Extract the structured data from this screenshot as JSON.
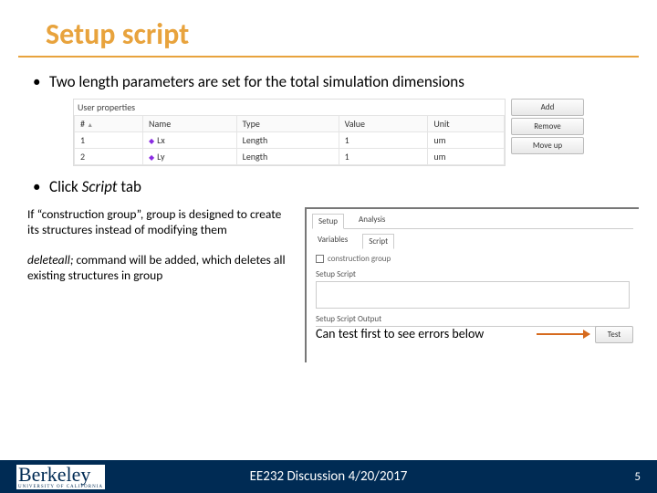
{
  "title": "Setup script",
  "bullets": {
    "b1": "Two length parameters are set for the total simulation dimensions",
    "b2_pre": "Click ",
    "b2_em": "Script",
    "b2_post": " tab"
  },
  "props": {
    "caption": "User properties",
    "headers": {
      "num": "#",
      "name": "Name",
      "type": "Type",
      "value": "Value",
      "unit": "Unit"
    },
    "rows": [
      {
        "num": "1",
        "name": "Lx",
        "type": "Length",
        "value": "1",
        "unit": "um"
      },
      {
        "num": "2",
        "name": "Ly",
        "type": "Length",
        "value": "1",
        "unit": "um"
      }
    ],
    "btn_add": "Add",
    "btn_remove": "Remove",
    "btn_moveup": "Move up"
  },
  "notes": {
    "n1": "If “construction group”, group is designed to create its structures instead of modifying them",
    "n2a": "deleteall;",
    "n2b": " command will be added, which deletes all existing structures in group"
  },
  "script_panel": {
    "tab_setup": "Setup",
    "tab_analysis": "Analysis",
    "tab_variables": "Variables",
    "tab_script": "Script",
    "chk_label": "construction group",
    "label_setup_script": "Setup Script",
    "label_output": "Setup Script Output",
    "btn_test": "Test",
    "annot": "Can test first to see errors below"
  },
  "footer": {
    "text": "EE232 Discussion 4/20/2017",
    "page": "5",
    "logo_main": "Berkeley",
    "logo_sub": "UNIVERSITY OF CALIFORNIA"
  }
}
